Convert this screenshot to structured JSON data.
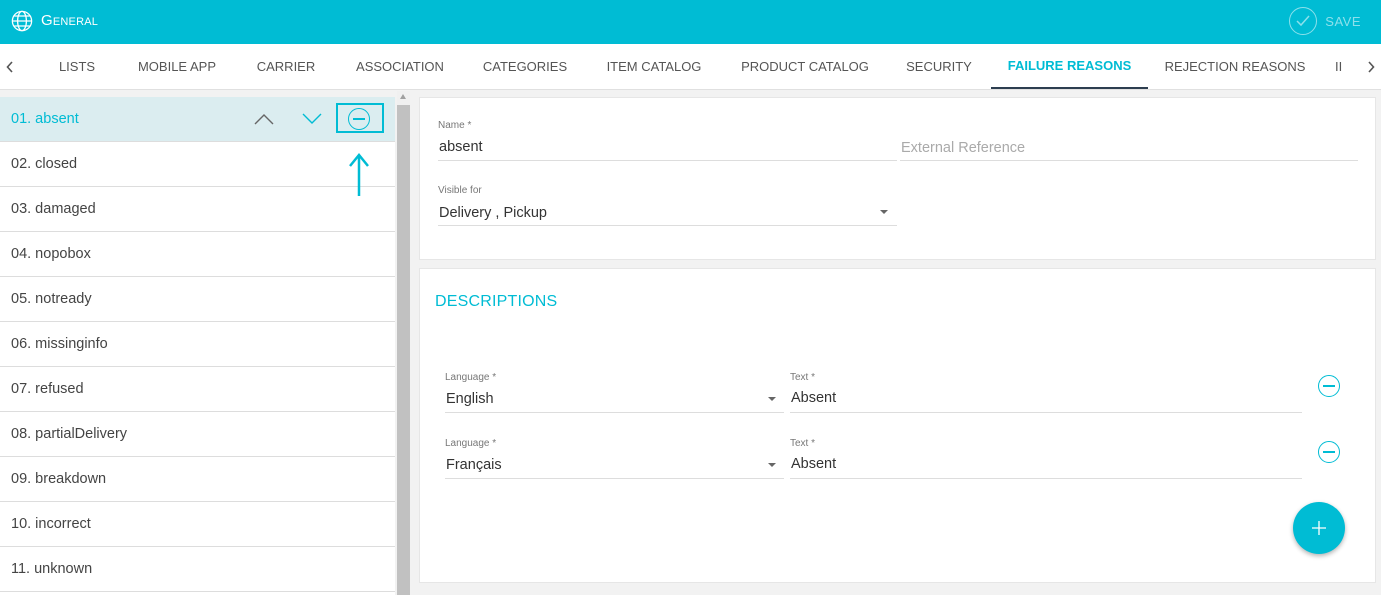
{
  "app": {
    "title": "General",
    "save_label": "SAVE"
  },
  "tabs": [
    {
      "label": "LISTS"
    },
    {
      "label": "MOBILE APP"
    },
    {
      "label": "CARRIER"
    },
    {
      "label": "ASSOCIATION"
    },
    {
      "label": "CATEGORIES"
    },
    {
      "label": "ITEM CATALOG"
    },
    {
      "label": "PRODUCT CATALOG"
    },
    {
      "label": "SECURITY"
    },
    {
      "label": "FAILURE REASONS"
    },
    {
      "label": "REJECTION REASONS"
    },
    {
      "label": "II"
    }
  ],
  "active_tab": "FAILURE REASONS",
  "list": {
    "items": [
      {
        "label": "01. absent"
      },
      {
        "label": "02. closed"
      },
      {
        "label": "03. damaged"
      },
      {
        "label": "04. nopobox"
      },
      {
        "label": "05. notready"
      },
      {
        "label": "06. missinginfo"
      },
      {
        "label": "07. refused"
      },
      {
        "label": "08. partialDelivery"
      },
      {
        "label": "09. breakdown"
      },
      {
        "label": "10. incorrect"
      },
      {
        "label": "11. unknown"
      }
    ],
    "selected": "01. absent"
  },
  "form": {
    "name_label": "Name *",
    "name_value": "absent",
    "external_ref_placeholder": "External Reference",
    "visible_for_label": "Visible for",
    "visible_for_value": "Delivery , Pickup"
  },
  "descriptions": {
    "title": "DESCRIPTIONS",
    "rows": [
      {
        "language_label": "Language *",
        "language_value": "English",
        "text_label": "Text *",
        "text_value": "Absent"
      },
      {
        "language_label": "Language *",
        "language_value": "Français",
        "text_label": "Text *",
        "text_value": "Absent"
      }
    ]
  },
  "colors": {
    "accent": "#00bcd4",
    "selected_row": "#dbedf0",
    "tab_underline": "#2d3e50"
  }
}
